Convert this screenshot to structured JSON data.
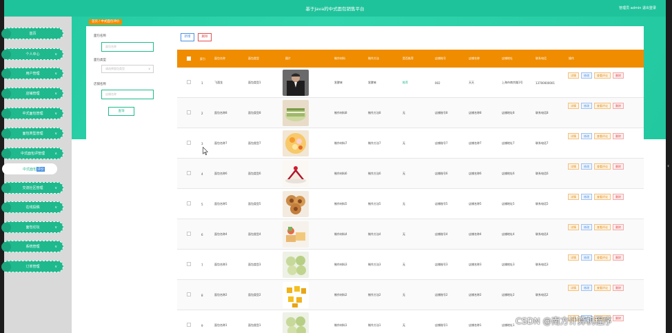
{
  "window": {
    "title": "基于Java的中式面包销售平台",
    "user_text": "管理员 admin  退出登录"
  },
  "sidebar": {
    "items": [
      {
        "label": "首页",
        "chev": ""
      },
      {
        "label": "个人中心",
        "chev": "∨"
      },
      {
        "label": "用户管理",
        "chev": "∨"
      },
      {
        "label": "店铺管理",
        "chev": "∨"
      },
      {
        "label": "中式面包管理",
        "chev": "∨"
      },
      {
        "label": "面包类型管理",
        "chev": "∨"
      },
      {
        "label": "中式面包评管理",
        "chev": "∧"
      },
      {
        "label": "交流社区管理",
        "chev": "∨"
      },
      {
        "label": "在线投稿",
        "chev": "∨"
      },
      {
        "label": "面包论坛",
        "chev": "∨"
      },
      {
        "label": "系统管理",
        "chev": "∨"
      },
      {
        "label": "订单管理",
        "chev": "∨"
      }
    ],
    "sub_item": {
      "label_prefix": "中式面包",
      "label_selected": "评价"
    }
  },
  "breadcrumb": {
    "text": "首页 / 中式面包评价"
  },
  "search": {
    "name_label": "面包名称",
    "name_placeholder": "面包名称",
    "type_label": "面包类型",
    "type_placeholder": "请选择面包类型",
    "shop_label": "店铺名称",
    "shop_placeholder": "店铺名称",
    "button": "查询"
  },
  "toolbar": {
    "add_label": "新增",
    "delete_label": "删除"
  },
  "table": {
    "headers": [
      "",
      "索引",
      "面包名称",
      "面包类型",
      "图片",
      "制作材料",
      "制作方法",
      "是否推荐",
      "店铺账号",
      "店铺名称",
      "店铺地址",
      "联系电话",
      "操作"
    ],
    "rows": [
      {
        "index": "1",
        "name": "飞酒龙",
        "type": "面包类型1",
        "material": "发酵来",
        "method": "发酵来",
        "recommend": "推荐",
        "account": "002",
        "shop": "天天",
        "address": "上海市南京路1号",
        "phone": "13700000001",
        "img": "suit"
      },
      {
        "index": "2",
        "name": "面包名称8",
        "type": "面包类型8",
        "material": "制作材料8",
        "method": "制作方法8",
        "recommend": "无",
        "account": "店铺账号8",
        "shop": "店铺名称8",
        "address": "店铺地址8",
        "phone": "联系电话8",
        "img": "matcha"
      },
      {
        "index": "3",
        "name": "面包名称7",
        "type": "面包类型7",
        "material": "制作材料7",
        "method": "制作方法7",
        "recommend": "无",
        "account": "店铺账号7",
        "shop": "店铺名称7",
        "address": "店铺地址7",
        "phone": "联系电话7",
        "img": "tart"
      },
      {
        "index": "4",
        "name": "面包名称6",
        "type": "面包类型6",
        "material": "制作材料6",
        "method": "制作方法6",
        "recommend": "无",
        "account": "店铺账号6",
        "shop": "店铺名称6",
        "address": "店铺地址6",
        "phone": "联系电话6",
        "img": "redcake"
      },
      {
        "index": "5",
        "name": "面包名称5",
        "type": "面包类型5",
        "material": "制作材料5",
        "method": "制作方法5",
        "recommend": "无",
        "account": "店铺账号5",
        "shop": "店铺名称5",
        "address": "店铺地址5",
        "phone": "联系电话5",
        "img": "roll"
      },
      {
        "index": "6",
        "name": "面包名称4",
        "type": "面包类型4",
        "material": "制作材料4",
        "method": "制作方法4",
        "recommend": "无",
        "account": "店铺账号4",
        "shop": "店铺名称4",
        "address": "店铺地址4",
        "phone": "联系电话4",
        "img": "pastry"
      },
      {
        "index": "7",
        "name": "面包名称3",
        "type": "面包类型3",
        "material": "制作材料3",
        "method": "制作方法3",
        "recommend": "无",
        "account": "店铺账号3",
        "shop": "店铺名称3",
        "address": "店铺地址3",
        "phone": "联系电话3",
        "img": "greenbun"
      },
      {
        "index": "8",
        "name": "面包名称2",
        "type": "面包类型2",
        "material": "制作材料2",
        "method": "制作方法2",
        "recommend": "无",
        "account": "店铺账号2",
        "shop": "店铺名称2",
        "address": "店铺地址2",
        "phone": "联系电话2",
        "img": "goldcake"
      },
      {
        "index": "9",
        "name": "面包名称1",
        "type": "面包类型1",
        "material": "制作材料1",
        "method": "制作方法1",
        "recommend": "无",
        "account": "店铺账号1",
        "shop": "店铺名称1",
        "address": "店铺地址1",
        "phone": "",
        "img": "greenbun"
      }
    ],
    "ops": {
      "detail": "详情",
      "edit": "修改",
      "review": "查看评论",
      "delete": "删除"
    }
  },
  "colors": {
    "accent": "#1fb98d",
    "header": "#f08c00",
    "banner": "#1fc39b"
  },
  "watermark": "CSDN @南方计算机程序"
}
